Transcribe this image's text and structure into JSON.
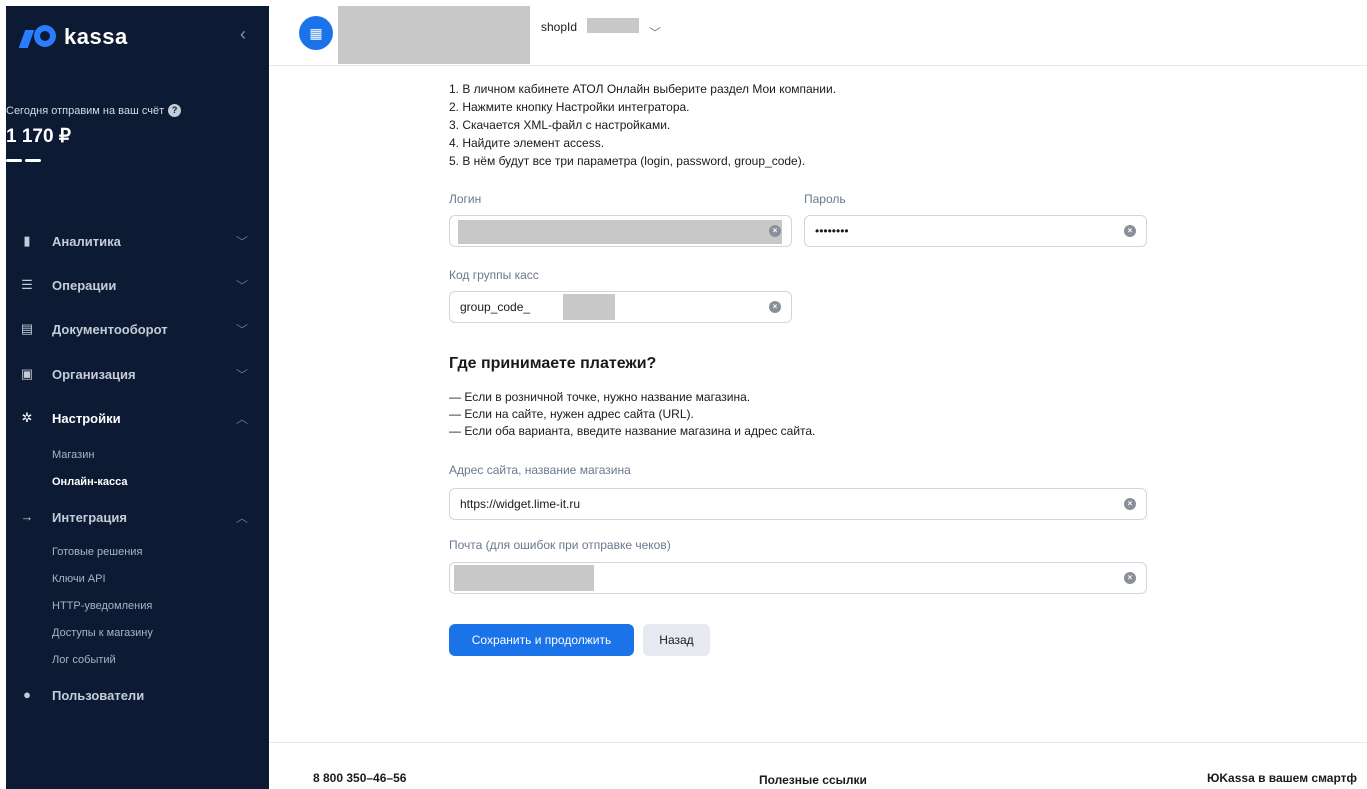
{
  "brand": {
    "logo_text": "kassa"
  },
  "balance": {
    "label": "Сегодня отправим на ваш счёт",
    "amount": "1 170 ₽"
  },
  "nav": [
    {
      "label": "Аналитика",
      "icon": "bar-chart-icon"
    },
    {
      "label": "Операции",
      "icon": "list-icon"
    },
    {
      "label": "Документооборот",
      "icon": "document-icon"
    },
    {
      "label": "Организация",
      "icon": "building-icon"
    },
    {
      "label": "Настройки",
      "icon": "gear-icon"
    },
    {
      "label": "Интеграция",
      "icon": "arrow-right-icon"
    },
    {
      "label": "Пользователи",
      "icon": "user-icon"
    }
  ],
  "settings_sub": [
    "Магазин",
    "Онлайн-касса"
  ],
  "integration_sub": [
    "Готовые решения",
    "Ключи API",
    "HTTP-уведомления",
    "Доступы к магазину",
    "Лог событий"
  ],
  "header": {
    "shopid_label": "shopId"
  },
  "instructions": [
    "1. В личном кабинете АТОЛ Онлайн выберите раздел Мои компании.",
    "2. Нажмите кнопку Настройки интегратора.",
    "3. Скачается XML-файл с настройками.",
    "4. Найдите элемент access.",
    "5. В нём будут все три параметра (login, password, group_code)."
  ],
  "form": {
    "login_label": "Логин",
    "password_label": "Пароль",
    "password_value": "••••••••",
    "group_label": "Код группы касс",
    "group_value": "group_code_",
    "section_title": "Где принимаете платежи?",
    "bullets": [
      "— Если в розничной точке, нужно название магазина.",
      "— Если на сайте, нужен адрес сайта (URL).",
      "— Если оба варианта, введите название магазина и адрес сайта."
    ],
    "site_label": "Адрес сайта, название магазина",
    "site_value": "https://widget.lime-it.ru",
    "email_label": "Почта (для ошибок при отправке чеков)",
    "save_button": "Сохранить и продолжить",
    "back_button": "Назад"
  },
  "footer": {
    "phone": "8 800 350–46–56",
    "links": "Полезные ссылки",
    "app": "ЮKassa в вашем смартф"
  },
  "colors": {
    "sidebar_bg": "#0d1a33",
    "accent": "#1a73e8"
  }
}
